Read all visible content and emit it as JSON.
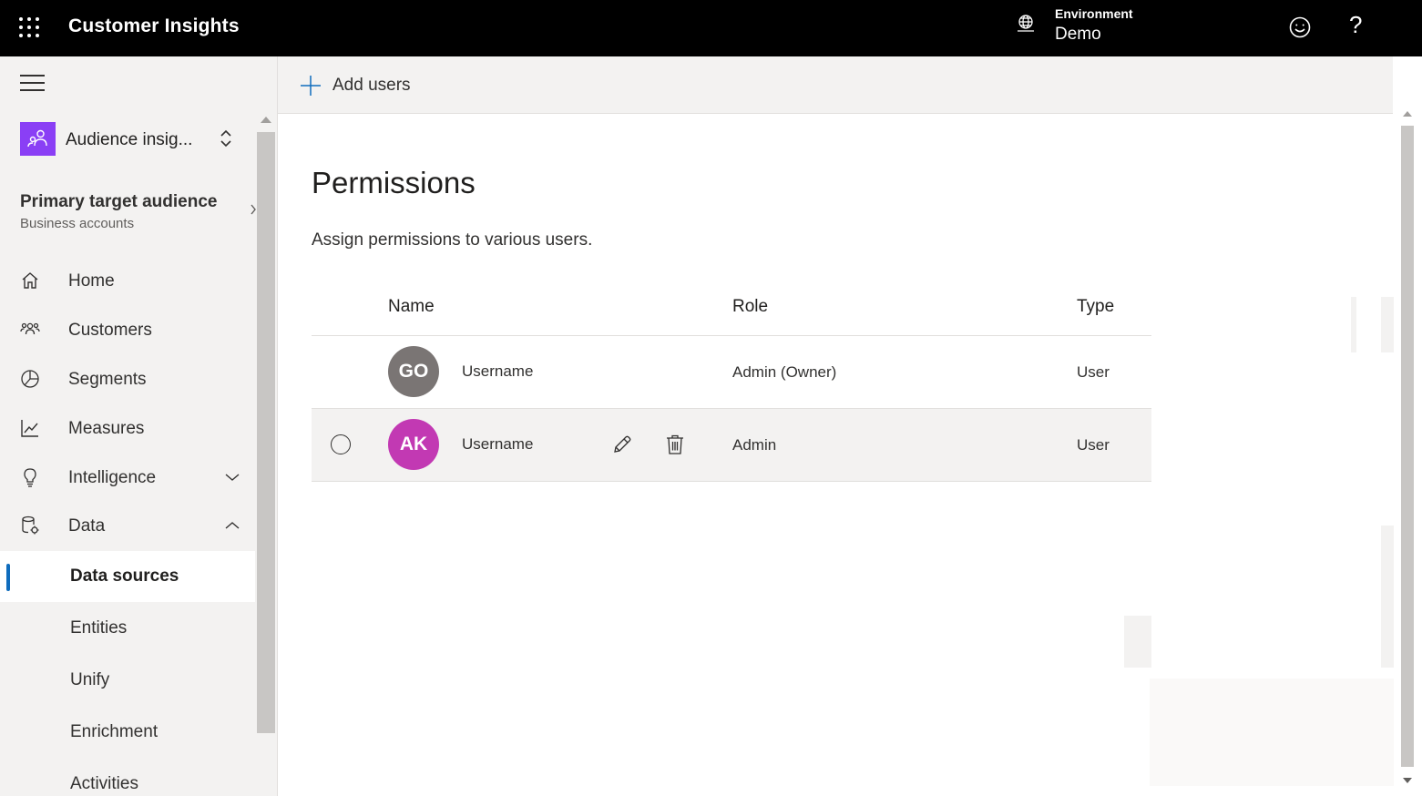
{
  "topbar": {
    "app_title": "Customer Insights",
    "environment_label": "Environment",
    "environment_value": "Demo",
    "help_glyph": "?"
  },
  "sidebar": {
    "environment_name": "Audience insig...",
    "audience_title": "Primary target audience",
    "audience_subtitle": "Business accounts",
    "nav_items": [
      {
        "label": "Home",
        "icon": "home-icon"
      },
      {
        "label": "Customers",
        "icon": "customers-icon"
      },
      {
        "label": "Segments",
        "icon": "segments-icon"
      },
      {
        "label": "Measures",
        "icon": "measures-icon"
      },
      {
        "label": "Intelligence",
        "icon": "intelligence-icon",
        "expanded": false
      },
      {
        "label": "Data",
        "icon": "data-icon",
        "expanded": true
      }
    ],
    "data_sub_items": [
      {
        "label": "Data sources",
        "active": true
      },
      {
        "label": "Entities"
      },
      {
        "label": "Unify"
      },
      {
        "label": "Enrichment"
      },
      {
        "label": "Activities"
      }
    ]
  },
  "commandbar": {
    "add_users_label": "Add users"
  },
  "page": {
    "title": "Permissions",
    "description": "Assign permissions to various users."
  },
  "table": {
    "columns": [
      "Name",
      "Role",
      "Type"
    ],
    "rows": [
      {
        "initials": "GO",
        "name": "Username",
        "role": "Admin (Owner)",
        "type": "User",
        "avatar_color": "#7a7574",
        "selected": false
      },
      {
        "initials": "AK",
        "name": "Username",
        "role": "Admin",
        "type": "User",
        "avatar_color": "#c239b3",
        "selected": true
      }
    ]
  },
  "colors": {
    "accent": "#0f6cbd",
    "env_tile": "#8a3ff5"
  }
}
